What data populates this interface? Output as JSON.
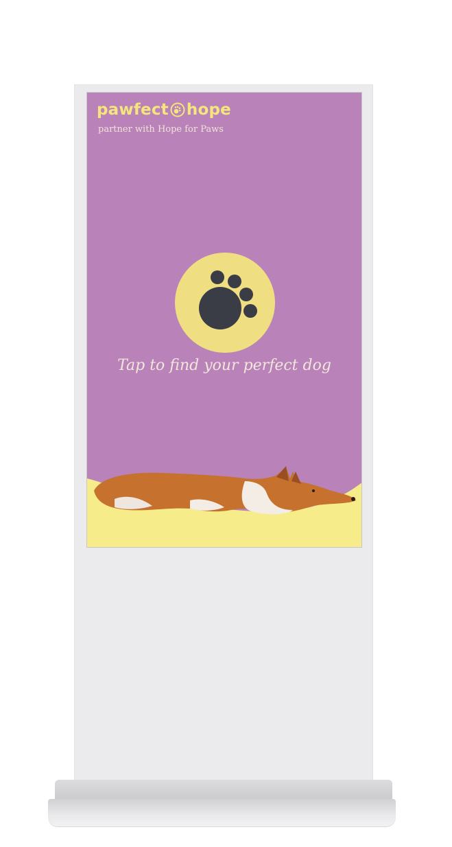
{
  "brand": {
    "name_left": "pawfect",
    "name_right": "hope",
    "logo_icon": "paw-circle-icon",
    "tagline": "partner with Hope for Paws"
  },
  "screen": {
    "main_icon": "paw-icon",
    "cta": "Tap to find your perfect dog",
    "illustration": "corgi-lying-down-image"
  },
  "colors": {
    "screen_bg": "#b982b8",
    "accent_yellow": "#f4e57e",
    "paw_dark": "#3a3d45",
    "circle_yellow": "#f0df82"
  }
}
